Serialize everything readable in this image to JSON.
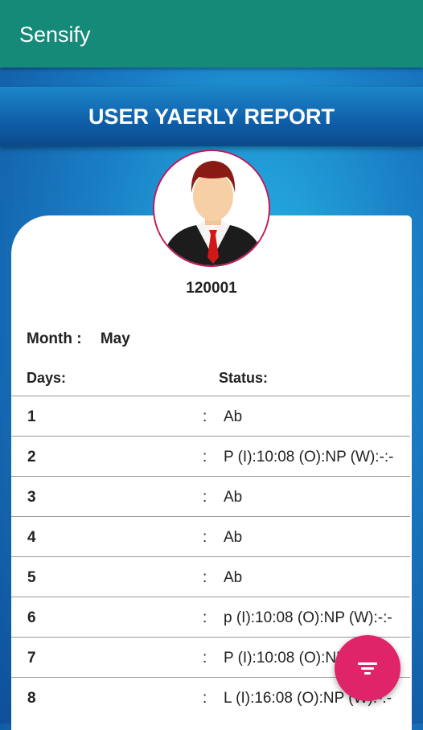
{
  "app": {
    "title": "Sensify"
  },
  "report": {
    "title": "USER YAERLY REPORT"
  },
  "user": {
    "id": "120001"
  },
  "month": {
    "label": "Month :",
    "value": "May"
  },
  "columns": {
    "days": "Days:",
    "status": "Status:"
  },
  "separator": ":",
  "rows": [
    {
      "day": "1",
      "status": "Ab"
    },
    {
      "day": "2",
      "status": "P (I):10:08 (O):NP (W):-:-"
    },
    {
      "day": "3",
      "status": "Ab"
    },
    {
      "day": "4",
      "status": "Ab"
    },
    {
      "day": "5",
      "status": "Ab"
    },
    {
      "day": "6",
      "status": "p (I):10:08 (O):NP (W):-:-"
    },
    {
      "day": "7",
      "status": "P (I):10:08 (O):NP (W):-:-"
    },
    {
      "day": "8",
      "status": "L (I):16:08 (O):NP (W):-:-"
    }
  ],
  "fab": {
    "icon": "filter-icon",
    "color": "#e0246a"
  },
  "colors": {
    "appbar": "#158a78",
    "avatar_border": "#c2185b"
  }
}
